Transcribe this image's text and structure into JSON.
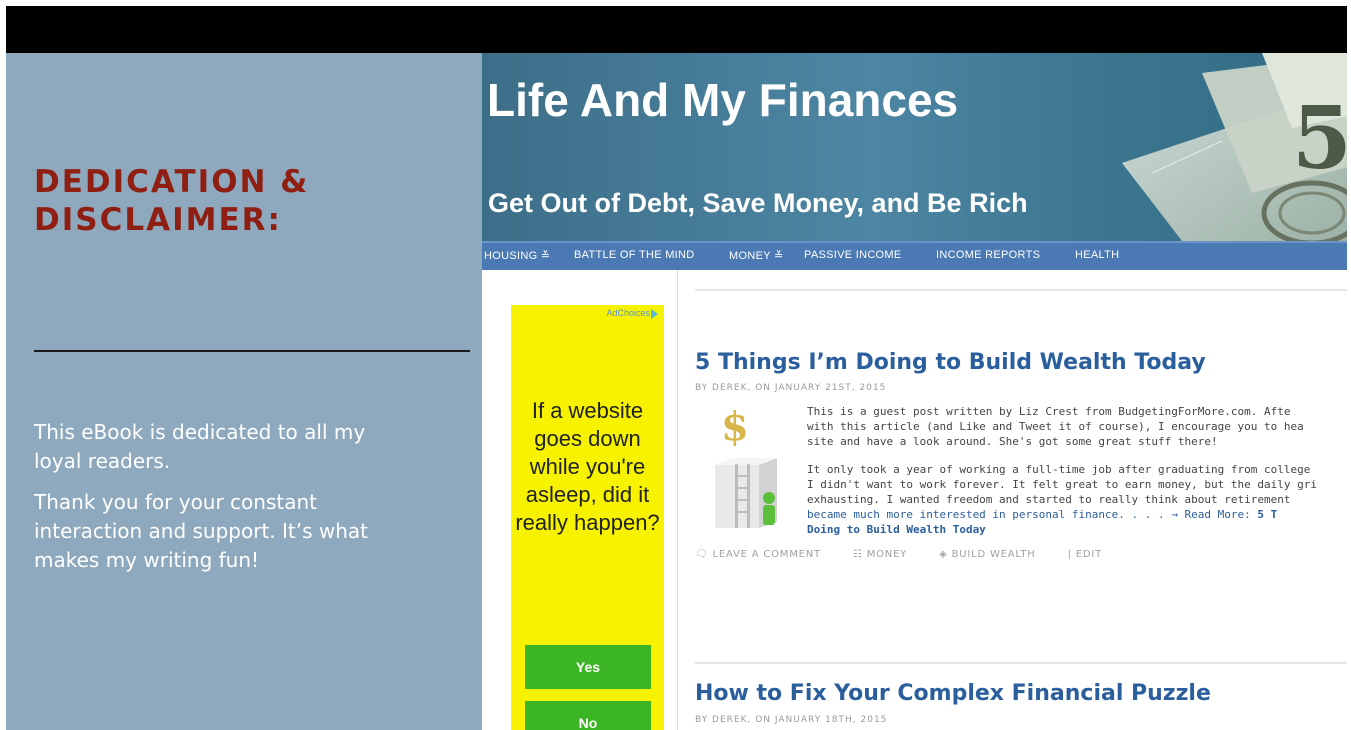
{
  "slide": {
    "heading": "DEDICATION & DISCLAIMER:",
    "paragraph1": "This eBook is dedicated to all my loyal readers.",
    "paragraph2": "Thank you for your constant interaction and support. It’s what makes my writing fun!"
  },
  "site": {
    "title": "Life And My Finances",
    "tagline": "Get Out of Debt, Save Money, and Be Rich"
  },
  "nav": {
    "items": [
      "HOUSING ≚",
      "BATTLE OF THE MIND",
      "MONEY ≚",
      "PASSIVE INCOME",
      "INCOME REPORTS",
      "HEALTH"
    ]
  },
  "ad": {
    "choices": "AdChoices",
    "question": "If a website goes down while you're asleep, did it really happen?",
    "yes": "Yes",
    "no": "No"
  },
  "posts": [
    {
      "title": "5 Things I’m Doing to Build Wealth Today",
      "byline": "BY DEREK, ON JANUARY 21ST, 2015",
      "p1_l1": "This is a guest post written by Liz Crest from BudgetingForMore.com. Afte",
      "p1_l2": "with this article (and Like and Tweet it of course), I encourage you to hea",
      "p1_l3": "site and have a look around. She's got some great stuff there!",
      "p2_l1": "It only took a year of working a full-time job after graduating from college",
      "p2_l2": "I didn't want to work forever. It felt great to earn money, but the daily gri",
      "p2_l3": "exhausting. I wanted freedom and started to really think about retirement",
      "p2_l4": "became much more interested in personal finance. . . . → Read More:",
      "readmore_link": "5 T",
      "readmore_cont": "Doing to Build Wealth Today",
      "comment": "LEAVE A COMMENT",
      "category": "MONEY",
      "tag": "BUILD WEALTH",
      "edit": "| EDIT"
    },
    {
      "title": "How to Fix Your Complex Financial Puzzle",
      "byline": "BY DEREK, ON JANUARY 18TH, 2015"
    }
  ],
  "colors": {
    "panel": "#8ea9bd",
    "heading": "#8e1f12",
    "nav": "#4b79b4",
    "link": "#2a5e9c",
    "ad_bg": "#f6f200",
    "ad_button": "#3cb524"
  }
}
